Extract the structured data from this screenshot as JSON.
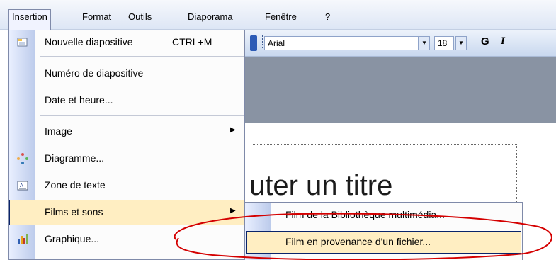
{
  "menubar": {
    "items": [
      {
        "label": "Insertion"
      },
      {
        "label": "Format"
      },
      {
        "label": "Outils"
      },
      {
        "label": "Diaporama"
      },
      {
        "label": "Fenêtre"
      },
      {
        "label": "?"
      }
    ]
  },
  "toolbar": {
    "font_name": "Arial",
    "font_size": "18",
    "bold_label": "G",
    "italic_label": "I"
  },
  "slide": {
    "title_text": "uter un titre"
  },
  "insert_menu": {
    "items": [
      {
        "label": "Nouvelle diapositive",
        "shortcut": "CTRL+M",
        "icon": "new-slide-icon"
      },
      {
        "label": "Numéro de diapositive"
      },
      {
        "label": "Date et heure..."
      },
      {
        "label": "Image",
        "has_submenu": true
      },
      {
        "label": "Diagramme...",
        "icon": "diagram-icon"
      },
      {
        "label": "Zone de texte",
        "icon": "text-box-icon"
      },
      {
        "label": "Films et sons",
        "has_submenu": true,
        "highlighted": true
      },
      {
        "label": "Graphique...",
        "icon": "chart-icon"
      }
    ]
  },
  "submenu": {
    "items": [
      {
        "label": "Film de la Bibliothèque multimédia..."
      },
      {
        "label": "Film en provenance d'un fichier...",
        "highlighted": true
      }
    ]
  },
  "colors": {
    "highlight": "#ffeec2",
    "highlight_border": "#0a246a",
    "annotation": "#d40000"
  }
}
